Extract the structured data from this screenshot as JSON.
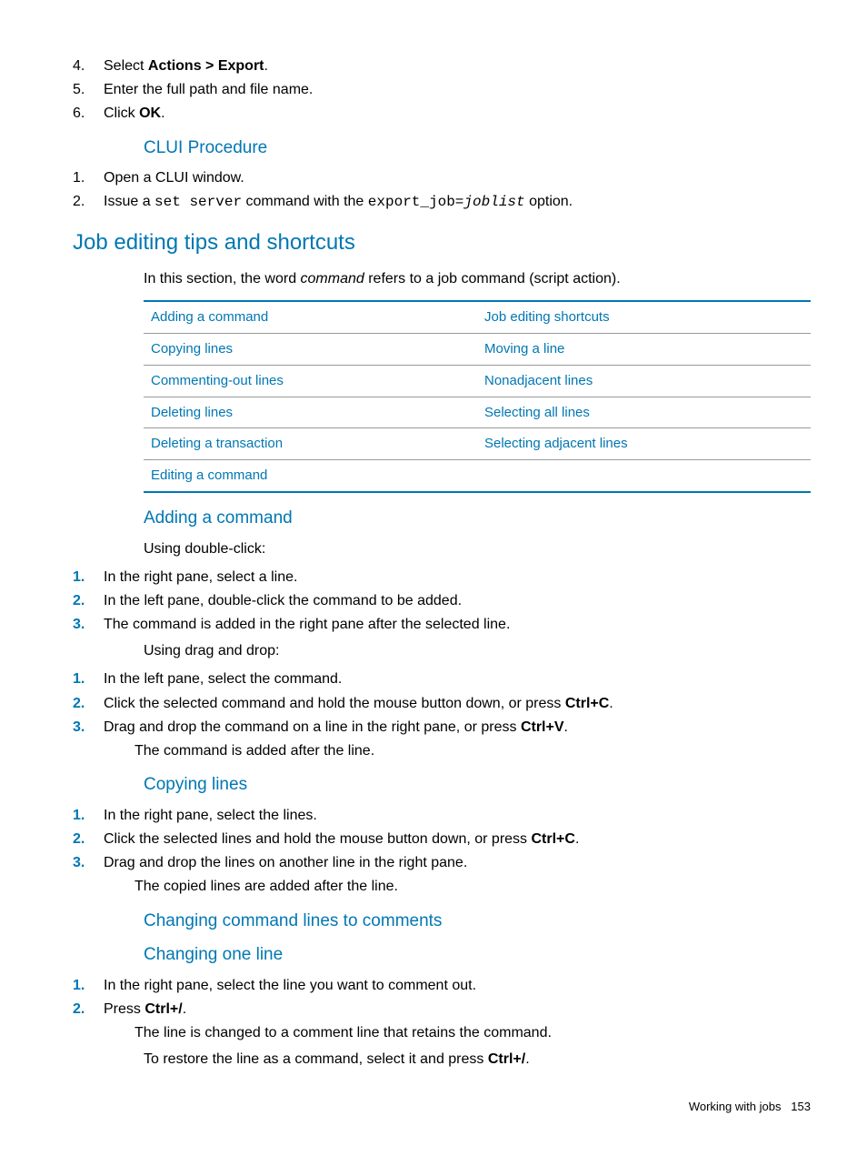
{
  "top_steps": [
    {
      "n": "4.",
      "pre": "Select ",
      "bold": "Actions > Export",
      "post": "."
    },
    {
      "n": "5.",
      "pre": "Enter the full path and file name.",
      "bold": "",
      "post": ""
    },
    {
      "n": "6.",
      "pre": "Click ",
      "bold": "OK",
      "post": "."
    }
  ],
  "clui": {
    "heading": "CLUI Procedure",
    "steps": [
      {
        "n": "1.",
        "html": "Open a CLUI window."
      },
      {
        "n": "2.",
        "html": "Issue a <span class='mono'>set server</span> command with the <span class='mono'>export_job=<span class='italic'>joblist</span></span> option."
      }
    ]
  },
  "h2": "Job editing tips and shortcuts",
  "intro": "In this section, the word <span class='italic'>command</span> refers to a job command (script action).",
  "table": [
    [
      "Adding a command",
      "Job editing shortcuts"
    ],
    [
      "Copying lines",
      "Moving a line"
    ],
    [
      "Commenting-out lines",
      "Nonadjacent lines"
    ],
    [
      "Deleting lines",
      "Selecting all lines"
    ],
    [
      "Deleting a transaction",
      "Selecting adjacent lines"
    ],
    [
      "Editing a command",
      ""
    ]
  ],
  "adding": {
    "heading": "Adding a command",
    "lead1": "Using double-click:",
    "steps1": [
      {
        "n": "1.",
        "html": "In the right pane, select a line."
      },
      {
        "n": "2.",
        "html": "In the left pane, double-click the command to be added."
      },
      {
        "n": "3.",
        "html": "The command is added in the right pane after the selected line."
      }
    ],
    "lead2": "Using drag and drop:",
    "steps2": [
      {
        "n": "1.",
        "html": "In the left pane, select the command."
      },
      {
        "n": "2.",
        "html": "Click the selected command and hold the mouse button down, or press <span class='bold'>Ctrl+C</span>."
      },
      {
        "n": "3.",
        "html": "Drag and drop the command on a line in the right pane, or press <span class='bold'>Ctrl+V</span>.<div class='sub-line'>The command is added after the line.</div>"
      }
    ]
  },
  "copying": {
    "heading": "Copying lines",
    "steps": [
      {
        "n": "1.",
        "html": "In the right pane, select the lines."
      },
      {
        "n": "2.",
        "html": "Click the selected lines and hold the mouse button down, or press <span class='bold'>Ctrl+C</span>."
      },
      {
        "n": "3.",
        "html": "Drag and drop the lines on another line in the right pane.<div class='sub-line'>The copied lines are added after the line.</div>"
      }
    ]
  },
  "changing": {
    "heading1": "Changing command lines to comments",
    "heading2": "Changing one line",
    "steps": [
      {
        "n": "1.",
        "html": "In the right pane, select the line you want to comment out."
      },
      {
        "n": "2.",
        "html": "Press <span class='bold'>Ctrl+/</span>.<div class='sub-line'>The line is changed to a comment line that retains the command.</div>"
      }
    ],
    "after": "To restore the line as a command, select it and press <span class='bold'>Ctrl+/</span>."
  },
  "footer": {
    "label": "Working with jobs",
    "page": "153"
  }
}
